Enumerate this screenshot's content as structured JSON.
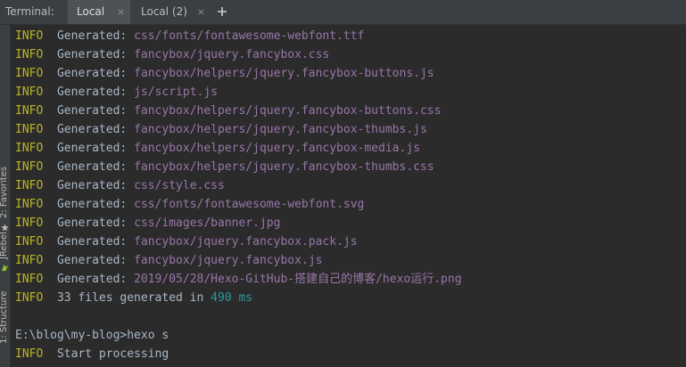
{
  "tabbar": {
    "title": "Terminal:",
    "tabs": [
      {
        "label": "Local",
        "close": "×"
      },
      {
        "label": "Local (2)",
        "close": "×"
      }
    ]
  },
  "sidebar": {
    "favorites": "2: Favorites",
    "jrebel": "JRebel",
    "structure": "1: Structure"
  },
  "terminal": {
    "level": "INFO",
    "generated_prefix": "Generated:",
    "generated_files": [
      "css/fonts/fontawesome-webfont.ttf",
      "fancybox/jquery.fancybox.css",
      "fancybox/helpers/jquery.fancybox-buttons.js",
      "js/script.js",
      "fancybox/helpers/jquery.fancybox-buttons.css",
      "fancybox/helpers/jquery.fancybox-thumbs.js",
      "fancybox/helpers/jquery.fancybox-media.js",
      "fancybox/helpers/jquery.fancybox-thumbs.css",
      "css/style.css",
      "css/fonts/fontawesome-webfont.svg",
      "css/images/banner.jpg",
      "fancybox/jquery.fancybox.pack.js",
      "fancybox/jquery.fancybox.js",
      "2019/05/28/Hexo-GitHub-搭建自己的博客/hexo运行.png"
    ],
    "summary_prefix": "33 files generated in",
    "summary_time": "490 ms",
    "prompt": "E:\\blog\\my-blog>hexo s",
    "last_message": "Start processing"
  },
  "colors": {
    "background": "#2b2b2b",
    "info": "#bbb529",
    "path": "#9876aa",
    "number": "#299999",
    "text": "#a9b7c6"
  }
}
